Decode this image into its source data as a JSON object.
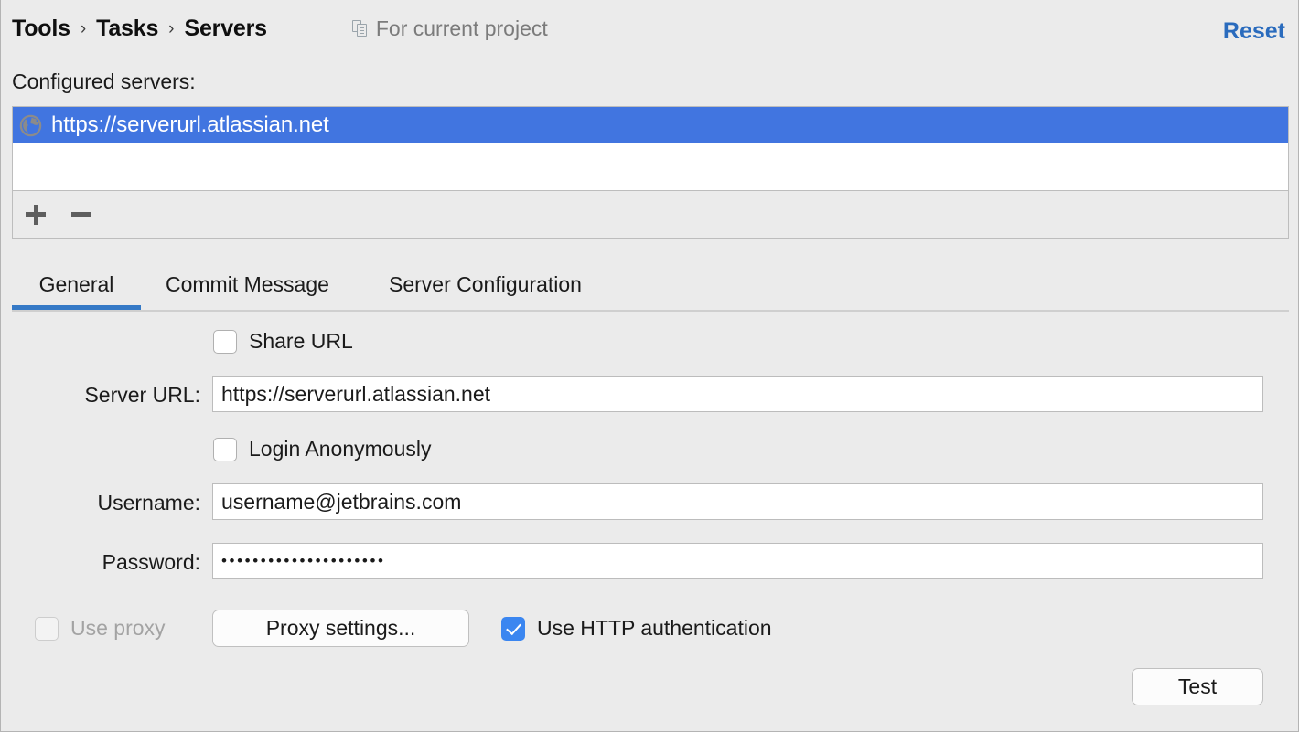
{
  "header": {
    "breadcrumb": [
      "Tools",
      "Tasks",
      "Servers"
    ],
    "separator": "›",
    "project_scope_label": "For current project",
    "project_scope_icon": "copy-icon",
    "reset_label": "Reset",
    "reset_color": "#2a6bbd"
  },
  "servers_section": {
    "label": "Configured servers:",
    "items": [
      {
        "icon": "globe-icon",
        "label": "https://serverurl.atlassian.net",
        "selected": true
      }
    ],
    "selection_color": "#4175e0",
    "toolbar": {
      "add_icon": "plus-icon",
      "remove_icon": "minus-icon"
    }
  },
  "tabs": {
    "active_index": 0,
    "active_color": "#3579c6",
    "items": [
      {
        "label": "General"
      },
      {
        "label": "Commit Message"
      },
      {
        "label": "Server Configuration"
      }
    ]
  },
  "general_tab": {
    "share_url": {
      "label": "Share URL",
      "checked": false,
      "enabled": true
    },
    "server_url": {
      "label": "Server URL:",
      "value": "https://serverurl.atlassian.net",
      "placeholder": ""
    },
    "login_anonymously": {
      "label": "Login Anonymously",
      "checked": false,
      "enabled": true
    },
    "username": {
      "label": "Username:",
      "value": "username@jetbrains.com",
      "placeholder": ""
    },
    "password": {
      "label": "Password:",
      "value": "•••••••••••••••••••••",
      "placeholder": ""
    },
    "use_proxy": {
      "label": "Use proxy",
      "checked": false,
      "enabled": false
    },
    "proxy_settings_button": "Proxy settings...",
    "use_http_auth": {
      "label": "Use HTTP authentication",
      "checked": true,
      "enabled": true,
      "color": "#3b86f0"
    },
    "test_button": "Test"
  }
}
